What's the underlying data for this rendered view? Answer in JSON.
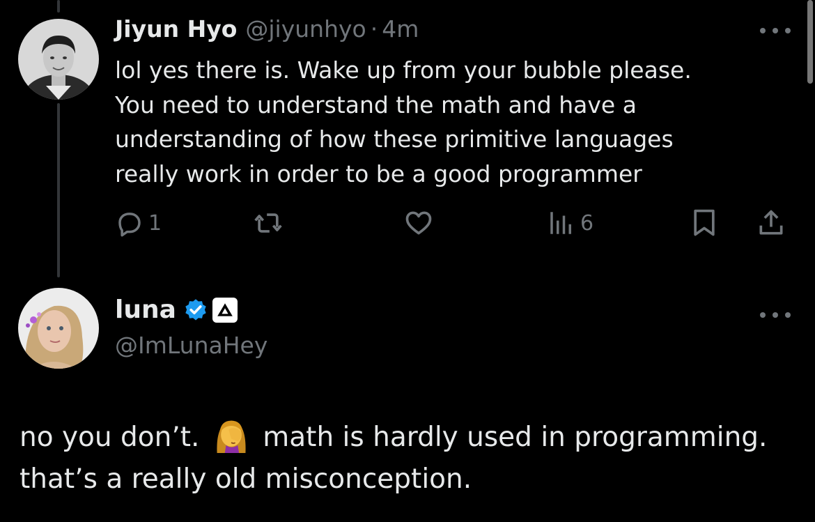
{
  "reply_tweet": {
    "author_name": "Jiyun Hyo",
    "author_handle": "@jiyunhyo",
    "separator": "·",
    "timestamp": "4m",
    "text_lines": [
      "lol yes there is. Wake up from your bubble please.",
      "You need to understand the math and have a",
      "understanding of how these primitive languages",
      "really work in order to be a good programmer"
    ],
    "actions": {
      "reply_count": "1",
      "retweet_count": "",
      "like_count": "",
      "views_count": "6"
    }
  },
  "quoted_tweet": {
    "author_name": "luna",
    "author_handle": "@ImLunaHey",
    "verified": true,
    "text_line_1_before": "no you don’t.",
    "text_line_1_emoji": "woman-facepalming",
    "text_line_1_after": "math is hardly used in programming.",
    "text_line_2": "that’s a really old misconception."
  },
  "icons": {
    "more": "more-horizontal-icon",
    "reply": "reply-bubble-icon",
    "retweet": "retweet-icon",
    "like": "heart-icon",
    "views": "views-bars-icon",
    "bookmark": "bookmark-icon",
    "share": "share-upload-icon",
    "verified": "verified-badge-icon",
    "affiliate": "affiliate-badge-icon"
  },
  "colors": {
    "background": "#000000",
    "text": "#e7e9ea",
    "secondary": "#71767b",
    "verified": "#1d9bf0",
    "thread_line": "#333639"
  }
}
